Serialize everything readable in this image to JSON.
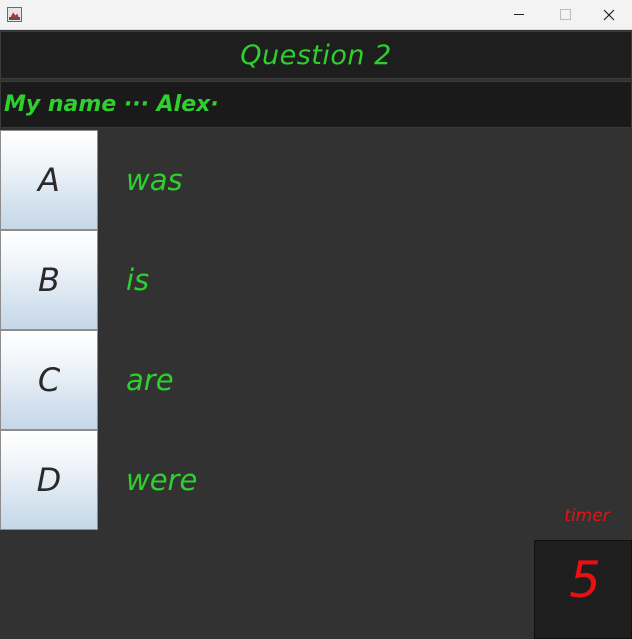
{
  "window": {
    "app_icon": "java-app-icon",
    "controls": {
      "minimize_icon": "minimize-icon",
      "maximize_icon": "maximize-icon",
      "close_icon": "close-icon"
    }
  },
  "quiz": {
    "title": "Question 2",
    "question": "My name ··· Alex·",
    "answers": [
      {
        "letter": "A",
        "text": "was"
      },
      {
        "letter": "B",
        "text": "is"
      },
      {
        "letter": "C",
        "text": "are"
      },
      {
        "letter": "D",
        "text": "were"
      }
    ]
  },
  "timer": {
    "label": "timer",
    "value": "5"
  },
  "colors": {
    "background": "#323232",
    "text_green": "#2ed02e",
    "timer_red": "#e81010",
    "header_dark": "#1e1e1e"
  }
}
